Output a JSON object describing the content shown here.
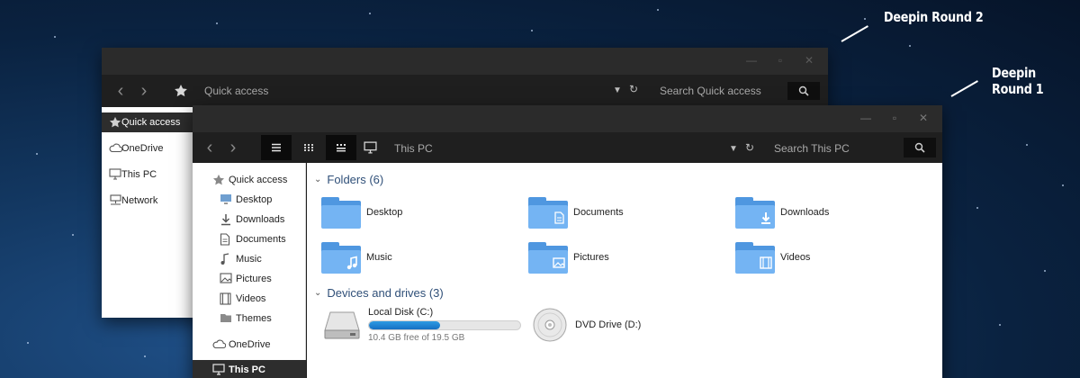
{
  "annotations": {
    "round2": "Deepin Round 2",
    "round1": "Deepin Round 1"
  },
  "back_window": {
    "address": "Quick access",
    "search_placeholder": "Search Quick access",
    "nav_items": [
      {
        "label": "Quick access",
        "icon": "star-icon",
        "selected": true
      },
      {
        "label": "OneDrive",
        "icon": "cloud-icon",
        "selected": false
      },
      {
        "label": "This PC",
        "icon": "monitor-icon",
        "selected": false
      },
      {
        "label": "Network",
        "icon": "network-icon",
        "selected": false
      }
    ]
  },
  "front_window": {
    "address": "This PC",
    "search_placeholder": "Search This PC",
    "nav_items": [
      {
        "label": "Quick access",
        "icon": "star-icon",
        "selected": false
      },
      {
        "label": "Desktop",
        "icon": "desktop-icon",
        "selected": false
      },
      {
        "label": "Downloads",
        "icon": "download-icon",
        "selected": false
      },
      {
        "label": "Documents",
        "icon": "document-icon",
        "selected": false
      },
      {
        "label": "Music",
        "icon": "music-icon",
        "selected": false
      },
      {
        "label": "Pictures",
        "icon": "picture-icon",
        "selected": false
      },
      {
        "label": "Videos",
        "icon": "video-icon",
        "selected": false
      },
      {
        "label": "Themes",
        "icon": "folder-icon",
        "selected": false
      },
      {
        "label": "OneDrive",
        "icon": "cloud-icon",
        "selected": false
      },
      {
        "label": "This PC",
        "icon": "monitor-icon",
        "selected": true
      }
    ],
    "folders_header": "Folders (6)",
    "folders": [
      {
        "label": "Desktop",
        "emblem": "none"
      },
      {
        "label": "Documents",
        "emblem": "document-icon"
      },
      {
        "label": "Downloads",
        "emblem": "download-icon"
      },
      {
        "label": "Music",
        "emblem": "music-icon"
      },
      {
        "label": "Pictures",
        "emblem": "picture-icon"
      },
      {
        "label": "Videos",
        "emblem": "video-icon"
      }
    ],
    "drives_header": "Devices and drives (3)",
    "drives": [
      {
        "label": "Local Disk (C:)",
        "free_text": "10.4 GB free of 19.5 GB",
        "used_fraction": 0.47,
        "icon": "hard-disk-icon"
      },
      {
        "label": "DVD Drive (D:)",
        "icon": "dvd-icon"
      }
    ]
  },
  "colors": {
    "folder_accent": "#74b4f3",
    "drive_bar": "#1f86d6",
    "window_chrome": "#1f1f1f"
  }
}
